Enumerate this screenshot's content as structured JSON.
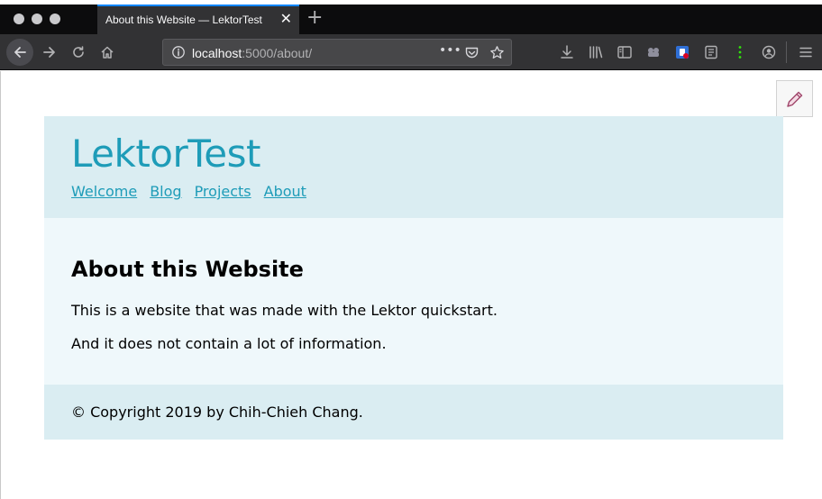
{
  "browser": {
    "tab": {
      "title": "About this Website — LektorTest"
    },
    "new_tab_label": "+",
    "address": {
      "host": "localhost",
      "rest": ":5000/about/"
    },
    "page_actions_label": "•••"
  },
  "site": {
    "title": "LektorTest",
    "nav": [
      "Welcome",
      "Blog",
      "Projects",
      "About"
    ],
    "page": {
      "heading": "About this Website",
      "paragraphs": [
        "This is a website that was made with the Lektor quickstart.",
        "And it does not contain a lot of information."
      ]
    },
    "footer": "© Copyright 2019 by Chih-Chieh Chang."
  },
  "colors": {
    "link": "#1e9cb8",
    "header_bg": "#daedf2",
    "body_bg": "#eff8fb",
    "tab_accent": "#0a84ff"
  },
  "icons": [
    "back-icon",
    "forward-icon",
    "reload-icon",
    "home-icon",
    "info-icon",
    "pocket-icon",
    "bookmark-star-icon",
    "download-icon",
    "library-icon",
    "sidebar-icon",
    "extension-icon",
    "account-icon",
    "menu-icon",
    "pencil-icon"
  ]
}
